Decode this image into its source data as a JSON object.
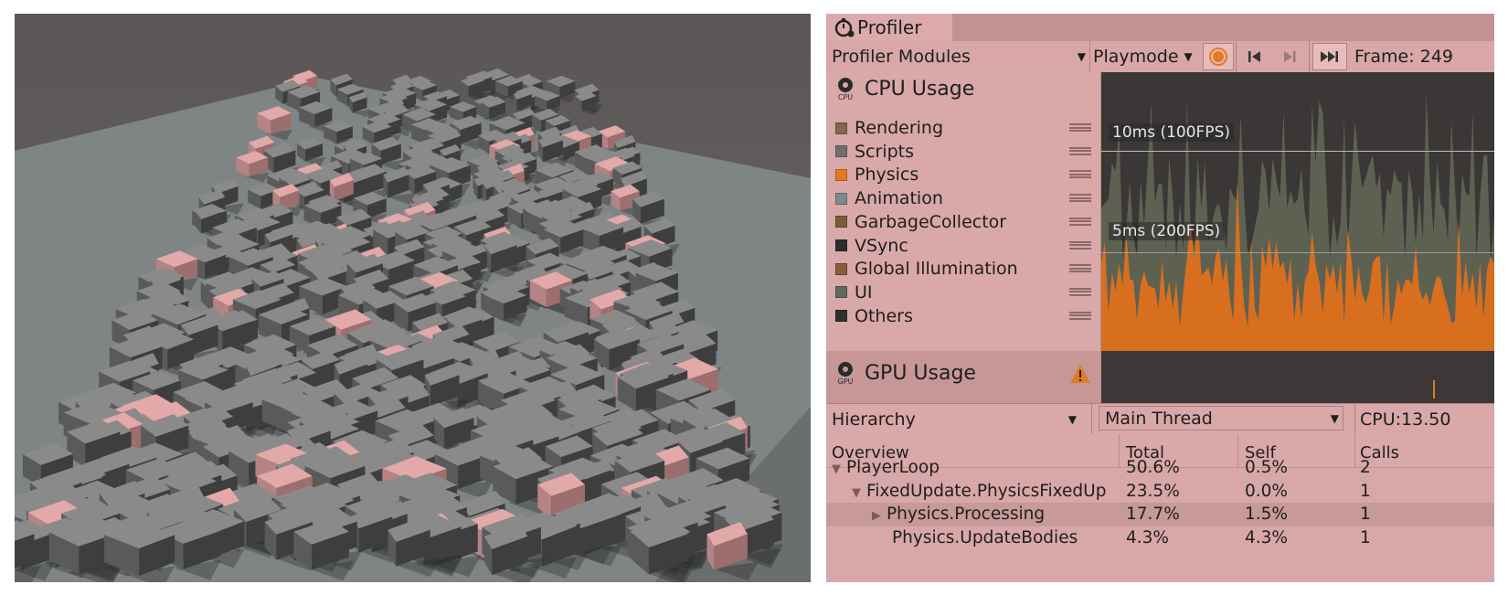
{
  "profiler": {
    "tab_title": "Profiler",
    "toolbar": {
      "modules_label": "Profiler Modules",
      "target_label": "Playmode",
      "frame_label": "Frame: 249"
    },
    "cpu_module": {
      "title": "CPU Usage",
      "icon_text": "CPU",
      "legend": [
        {
          "label": "Rendering",
          "color": "#7d6a4c"
        },
        {
          "label": "Scripts",
          "color": "#6f6f6f"
        },
        {
          "label": "Physics",
          "color": "#e07a24"
        },
        {
          "label": "Animation",
          "color": "#7c8a8a"
        },
        {
          "label": "GarbageCollector",
          "color": "#7a5d3a"
        },
        {
          "label": "VSync",
          "color": "#2d2d2d"
        },
        {
          "label": "Global Illumination",
          "color": "#8c5a3c"
        },
        {
          "label": "UI",
          "color": "#5f6a5f"
        },
        {
          "label": "Others",
          "color": "#303030"
        }
      ],
      "chart": {
        "line_10ms": "10ms (100FPS)",
        "line_5ms": "5ms (200FPS)"
      }
    },
    "gpu_module": {
      "title": "GPU Usage",
      "icon_text": "GPU"
    },
    "details": {
      "view_label": "Hierarchy",
      "thread_label": "Main Thread",
      "cpu_label": "CPU:13.50",
      "columns": [
        "Overview",
        "Total",
        "Self",
        "Calls"
      ],
      "rows": [
        {
          "name": "PlayerLoop",
          "total": "50.6%",
          "self": "0.5%",
          "calls": "2"
        },
        {
          "name": "FixedUpdate.PhysicsFixedUp",
          "total": "23.5%",
          "self": "0.0%",
          "calls": "1"
        },
        {
          "name": "Physics.Processing",
          "total": "17.7%",
          "self": "1.5%",
          "calls": "1"
        },
        {
          "name": "Physics.UpdateBodies",
          "total": "4.3%",
          "self": "4.3%",
          "calls": "1"
        }
      ]
    }
  },
  "colors": {
    "profiler_bg": "#d8a8a8",
    "chart_bg": "#3b3736",
    "physics": "#e07a24",
    "highlight_cube": "#e3a8a8"
  }
}
